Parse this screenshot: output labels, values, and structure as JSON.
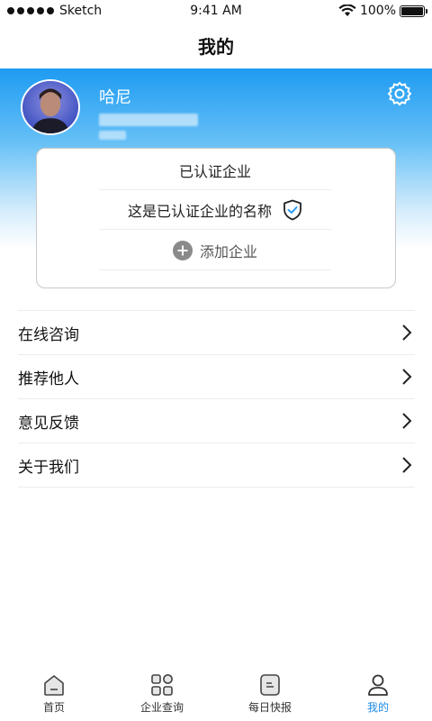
{
  "status_bar": {
    "carrier": "Sketch",
    "time": "9:41 AM",
    "battery_text": "100%",
    "battery_level": 1.0
  },
  "nav": {
    "title": "我的"
  },
  "profile": {
    "name": "哈尼"
  },
  "company_card": {
    "title": "已认证企业",
    "company_name": "这是已认证企业的名称",
    "add_label": "添加企业"
  },
  "menu": {
    "items": [
      {
        "label": "在线咨询"
      },
      {
        "label": "推荐他人"
      },
      {
        "label": "意见反馈"
      },
      {
        "label": "关于我们"
      }
    ]
  },
  "tabs": [
    {
      "label": "首页",
      "icon": "home-icon",
      "active": false
    },
    {
      "label": "企业查询",
      "icon": "grid-icon",
      "active": false
    },
    {
      "label": "每日快报",
      "icon": "news-icon",
      "active": false
    },
    {
      "label": "我的",
      "icon": "user-icon",
      "active": true
    }
  ],
  "colors": {
    "accent": "#1a8be8",
    "header_gradient_top": "#1e9bf2",
    "shield_check": "#2a9bf0"
  }
}
